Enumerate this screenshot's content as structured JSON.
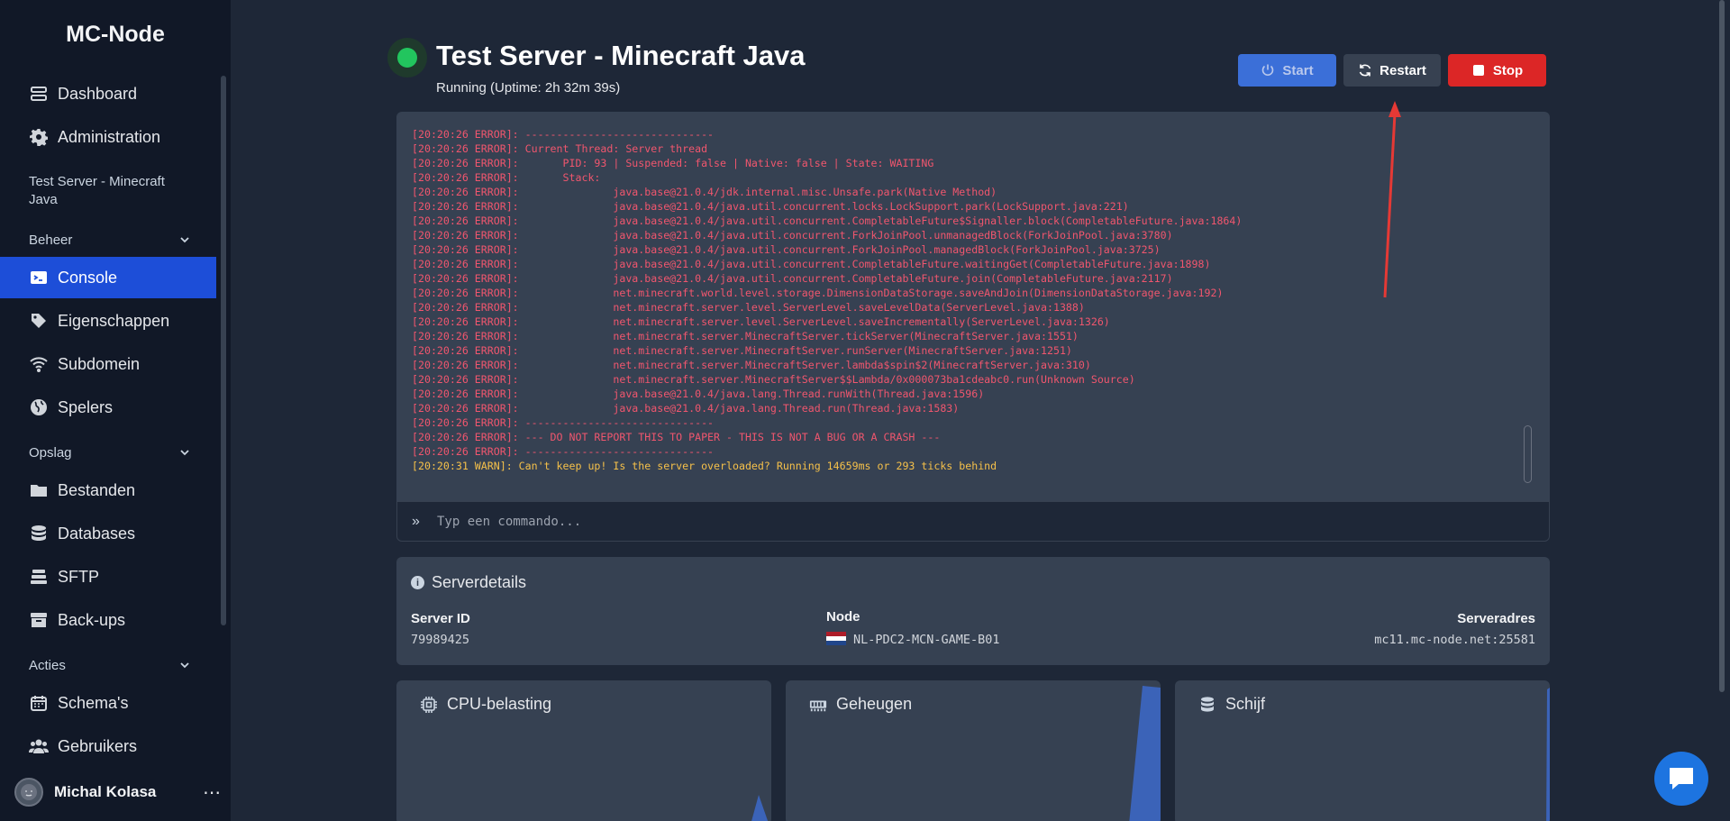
{
  "app": {
    "brand": "MC-Node"
  },
  "sidebar": {
    "top_items": [
      {
        "label": "Dashboard",
        "icon": "server-stack-icon"
      },
      {
        "label": "Administration",
        "icon": "gear-icon"
      }
    ],
    "server_label": "Test Server - Minecraft Java",
    "sections": [
      {
        "label": "Beheer"
      },
      {
        "label": "Opslag"
      },
      {
        "label": "Acties"
      }
    ],
    "beheer_items": [
      {
        "label": "Console",
        "icon": "terminal-icon",
        "active": true
      },
      {
        "label": "Eigenschappen",
        "icon": "tag-icon"
      },
      {
        "label": "Subdomein",
        "icon": "wifi-icon"
      },
      {
        "label": "Spelers",
        "icon": "globe-icon"
      }
    ],
    "opslag_items": [
      {
        "label": "Bestanden",
        "icon": "folder-icon"
      },
      {
        "label": "Databases",
        "icon": "database-icon"
      },
      {
        "label": "SFTP",
        "icon": "layers-icon"
      },
      {
        "label": "Back-ups",
        "icon": "archive-icon"
      }
    ],
    "acties_items": [
      {
        "label": "Schema's",
        "icon": "calendar-icon"
      },
      {
        "label": "Gebruikers",
        "icon": "users-icon"
      }
    ],
    "user": {
      "name": "Michal Kolasa"
    }
  },
  "header": {
    "title": "Test Server - Minecraft Java",
    "status": "Running (Uptime: 2h 32m 39s)",
    "status_color": "#22c55e",
    "buttons": {
      "start": "Start",
      "restart": "Restart",
      "stop": "Stop"
    }
  },
  "console": {
    "lines": [
      {
        "level": "error",
        "text": "[20:20:26 ERROR]: ------------------------------"
      },
      {
        "level": "error",
        "text": "[20:20:26 ERROR]: Current Thread: Server thread"
      },
      {
        "level": "error",
        "text": "[20:20:26 ERROR]:       PID: 93 | Suspended: false | Native: false | State: WAITING"
      },
      {
        "level": "error",
        "text": "[20:20:26 ERROR]:       Stack:"
      },
      {
        "level": "error",
        "text": "[20:20:26 ERROR]:               java.base@21.0.4/jdk.internal.misc.Unsafe.park(Native Method)"
      },
      {
        "level": "error",
        "text": "[20:20:26 ERROR]:               java.base@21.0.4/java.util.concurrent.locks.LockSupport.park(LockSupport.java:221)"
      },
      {
        "level": "error",
        "text": "[20:20:26 ERROR]:               java.base@21.0.4/java.util.concurrent.CompletableFuture$Signaller.block(CompletableFuture.java:1864)"
      },
      {
        "level": "error",
        "text": "[20:20:26 ERROR]:               java.base@21.0.4/java.util.concurrent.ForkJoinPool.unmanagedBlock(ForkJoinPool.java:3780)"
      },
      {
        "level": "error",
        "text": "[20:20:26 ERROR]:               java.base@21.0.4/java.util.concurrent.ForkJoinPool.managedBlock(ForkJoinPool.java:3725)"
      },
      {
        "level": "error",
        "text": "[20:20:26 ERROR]:               java.base@21.0.4/java.util.concurrent.CompletableFuture.waitingGet(CompletableFuture.java:1898)"
      },
      {
        "level": "error",
        "text": "[20:20:26 ERROR]:               java.base@21.0.4/java.util.concurrent.CompletableFuture.join(CompletableFuture.java:2117)"
      },
      {
        "level": "error",
        "text": "[20:20:26 ERROR]:               net.minecraft.world.level.storage.DimensionDataStorage.saveAndJoin(DimensionDataStorage.java:192)"
      },
      {
        "level": "error",
        "text": "[20:20:26 ERROR]:               net.minecraft.server.level.ServerLevel.saveLevelData(ServerLevel.java:1388)"
      },
      {
        "level": "error",
        "text": "[20:20:26 ERROR]:               net.minecraft.server.level.ServerLevel.saveIncrementally(ServerLevel.java:1326)"
      },
      {
        "level": "error",
        "text": "[20:20:26 ERROR]:               net.minecraft.server.MinecraftServer.tickServer(MinecraftServer.java:1551)"
      },
      {
        "level": "error",
        "text": "[20:20:26 ERROR]:               net.minecraft.server.MinecraftServer.runServer(MinecraftServer.java:1251)"
      },
      {
        "level": "error",
        "text": "[20:20:26 ERROR]:               net.minecraft.server.MinecraftServer.lambda$spin$2(MinecraftServer.java:310)"
      },
      {
        "level": "error",
        "text": "[20:20:26 ERROR]:               net.minecraft.server.MinecraftServer$$Lambda/0x000073ba1cdeabc0.run(Unknown Source)"
      },
      {
        "level": "error",
        "text": "[20:20:26 ERROR]:               java.base@21.0.4/java.lang.Thread.runWith(Thread.java:1596)"
      },
      {
        "level": "error",
        "text": "[20:20:26 ERROR]:               java.base@21.0.4/java.lang.Thread.run(Thread.java:1583)"
      },
      {
        "level": "error",
        "text": "[20:20:26 ERROR]: ------------------------------"
      },
      {
        "level": "error",
        "text": "[20:20:26 ERROR]: --- DO NOT REPORT THIS TO PAPER - THIS IS NOT A BUG OR A CRASH ---"
      },
      {
        "level": "error",
        "text": "[20:20:26 ERROR]: ------------------------------"
      },
      {
        "level": "warn",
        "text": "[20:20:31 WARN]: Can't keep up! Is the server overloaded? Running 14659ms or 293 ticks behind"
      }
    ],
    "colors": {
      "error": "#f0566e",
      "warn": "#f5c04a"
    },
    "command_placeholder": "Typ een commando..."
  },
  "details": {
    "title": "Serverdetails",
    "server_id_label": "Server ID",
    "server_id": "79989425",
    "node_label": "Node",
    "node": "NL-PDC2-MCN-GAME-B01",
    "address_label": "Serveradres",
    "address": "mc11.mc-node.net:25581"
  },
  "stats": {
    "cpu": {
      "title": "CPU-belasting",
      "icon": "cpu-icon"
    },
    "memory": {
      "title": "Geheugen",
      "icon": "memory-icon"
    },
    "disk": {
      "title": "Schijf",
      "icon": "disk-icon"
    }
  }
}
